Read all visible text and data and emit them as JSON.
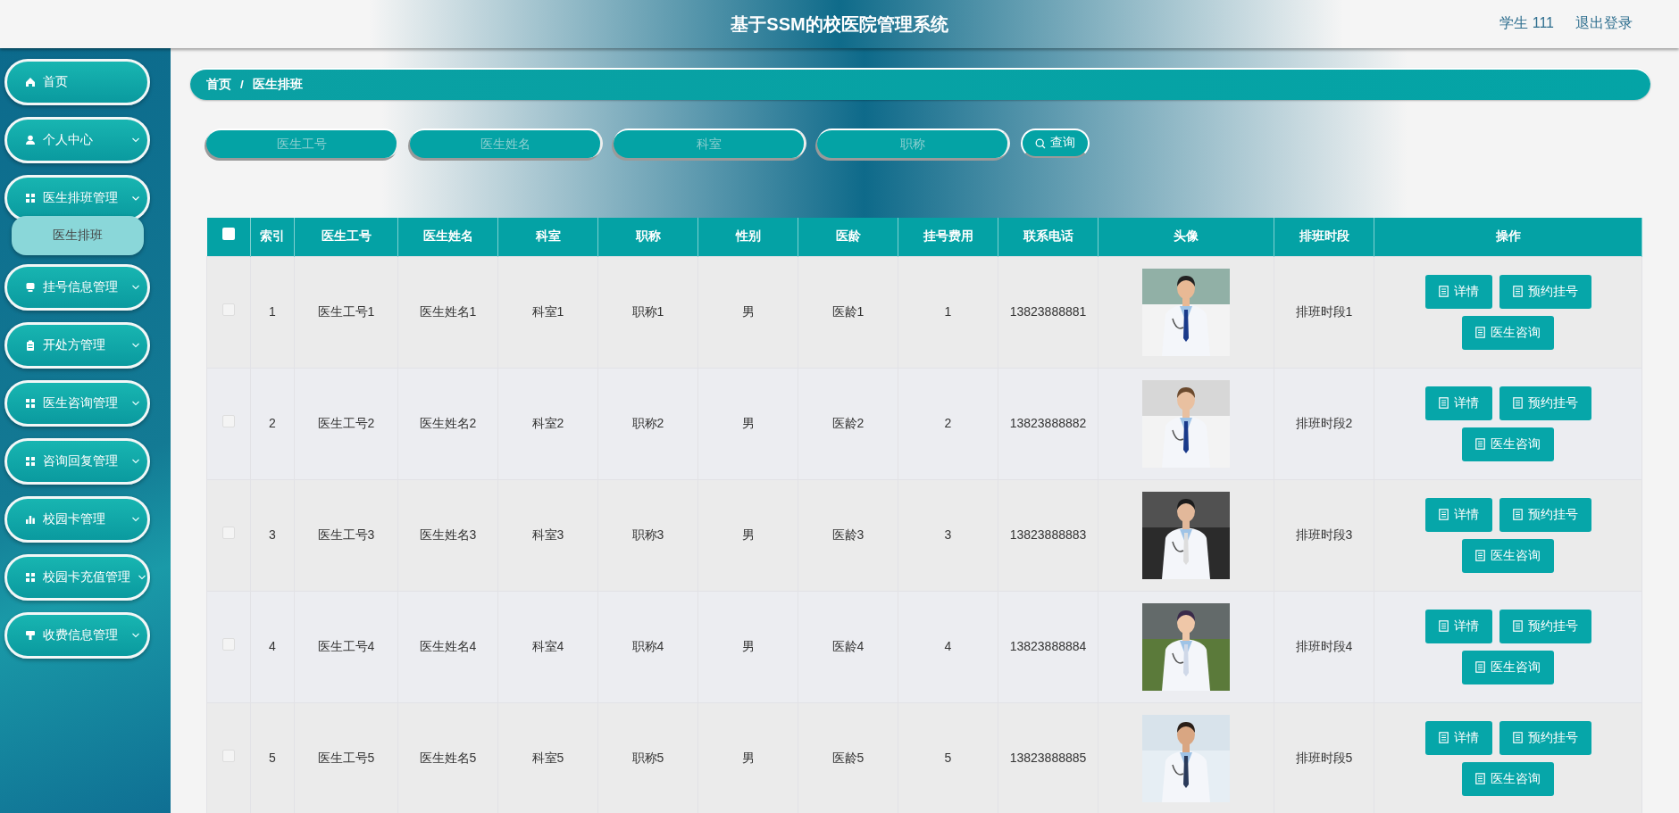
{
  "header": {
    "title": "基于SSM的校医院管理系统",
    "user": "学生 111",
    "logout": "退出登录"
  },
  "sidebar": {
    "items": [
      {
        "label": "首页",
        "kind": "link"
      },
      {
        "label": "个人中心",
        "kind": "menu",
        "expanded": false
      },
      {
        "label": "医生排班管理",
        "kind": "menu",
        "expanded": true,
        "children": [
          {
            "label": "医生排班",
            "selected": true
          }
        ]
      },
      {
        "label": "挂号信息管理",
        "kind": "menu",
        "expanded": false
      },
      {
        "label": "开处方管理",
        "kind": "menu",
        "expanded": false
      },
      {
        "label": "医生咨询管理",
        "kind": "menu",
        "expanded": false
      },
      {
        "label": "咨询回复管理",
        "kind": "menu",
        "expanded": false
      },
      {
        "label": "校园卡管理",
        "kind": "menu",
        "expanded": false
      },
      {
        "label": "校园卡充值管理",
        "kind": "menu",
        "expanded": false
      },
      {
        "label": "收费信息管理",
        "kind": "menu",
        "expanded": false
      }
    ]
  },
  "breadcrumb": {
    "items": [
      "首页",
      "医生排班"
    ],
    "separator": "/"
  },
  "search": {
    "fields": [
      {
        "placeholder": "医生工号"
      },
      {
        "placeholder": "医生姓名"
      },
      {
        "placeholder": "科室"
      },
      {
        "placeholder": "职称"
      }
    ],
    "button": "查询"
  },
  "table": {
    "select_all": {
      "checked": false
    },
    "columns": [
      "索引",
      "医生工号",
      "医生姓名",
      "科室",
      "职称",
      "性别",
      "医龄",
      "挂号费用",
      "联系电话",
      "头像",
      "排班时段",
      "操作"
    ],
    "rows": [
      {
        "checked": false,
        "cells": [
          "1",
          "医生工号1",
          "医生姓名1",
          "科室1",
          "职称1",
          "男",
          "医龄1",
          "1",
          "13823888881"
        ],
        "photo": {
          "kind": "picture"
        },
        "shift": "排班时段1",
        "actions": [
          "详情",
          "预约挂号",
          "医生咨询"
        ]
      },
      {
        "checked": false,
        "cells": [
          "2",
          "医生工号2",
          "医生姓名2",
          "科室2",
          "职称2",
          "男",
          "医龄2",
          "2",
          "13823888882"
        ],
        "photo": {
          "kind": "picture"
        },
        "shift": "排班时段2",
        "actions": [
          "详情",
          "预约挂号",
          "医生咨询"
        ]
      },
      {
        "checked": false,
        "cells": [
          "3",
          "医生工号3",
          "医生姓名3",
          "科室3",
          "职称3",
          "男",
          "医龄3",
          "3",
          "13823888883"
        ],
        "photo": {
          "kind": "picture"
        },
        "shift": "排班时段3",
        "actions": [
          "详情",
          "预约挂号",
          "医生咨询"
        ]
      },
      {
        "checked": false,
        "cells": [
          "4",
          "医生工号4",
          "医生姓名4",
          "科室4",
          "职称4",
          "男",
          "医龄4",
          "4",
          "13823888884"
        ],
        "photo": {
          "kind": "picture"
        },
        "shift": "排班时段4",
        "actions": [
          "详情",
          "预约挂号",
          "医生咨询"
        ]
      },
      {
        "checked": false,
        "cells": [
          "5",
          "医生工号5",
          "医生姓名5",
          "科室5",
          "职称5",
          "男",
          "医龄5",
          "5",
          "13823888885"
        ],
        "photo": {
          "kind": "picture"
        },
        "shift": "排班时段5",
        "actions": [
          "详情",
          "预约挂号",
          "医生咨询"
        ]
      }
    ]
  }
}
